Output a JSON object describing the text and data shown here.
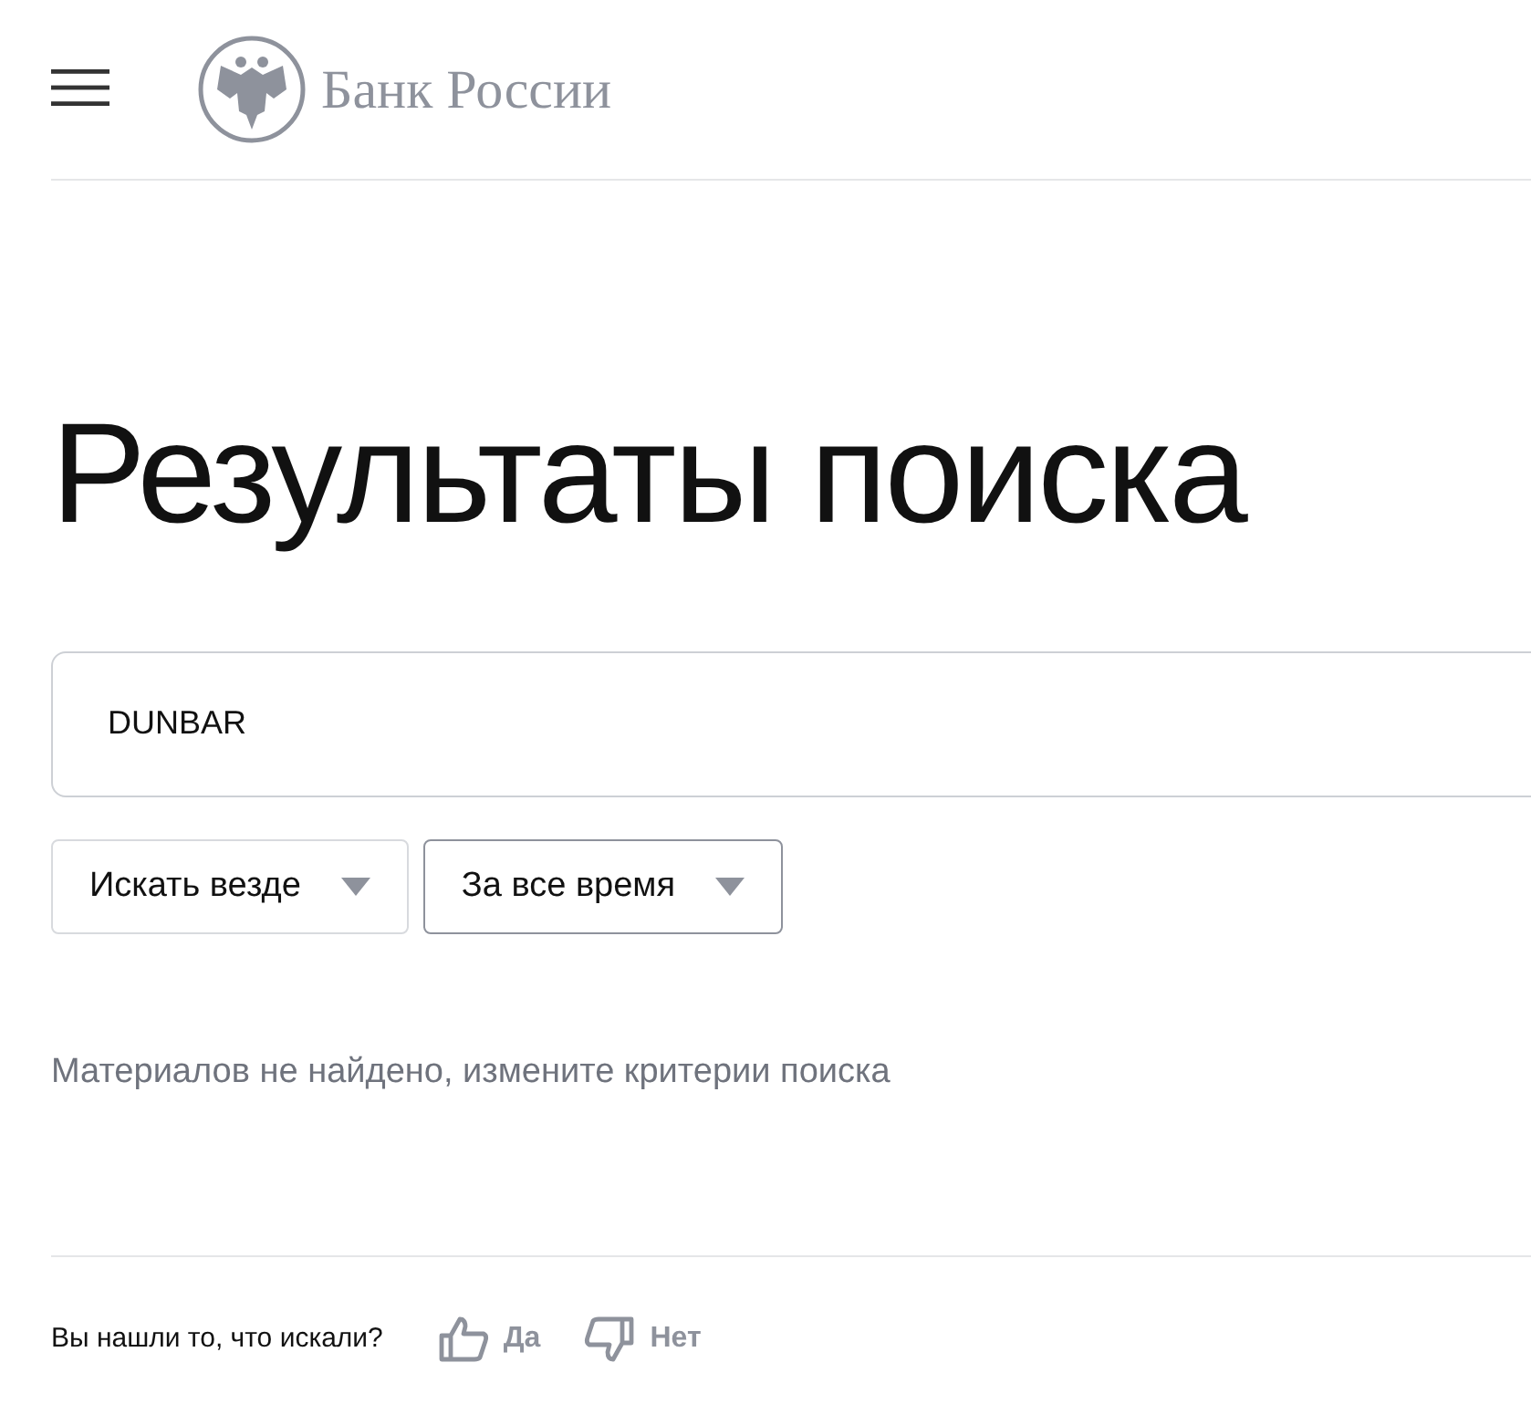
{
  "header": {
    "logo_text": "Банк России"
  },
  "title": "Результаты поиска",
  "search": {
    "value": "DUNBAR"
  },
  "filters": [
    {
      "label": "Искать везде",
      "selected": false
    },
    {
      "label": "За все время",
      "selected": true
    }
  ],
  "message": "Материалов не найдено, измените критерии поиска",
  "feedback": {
    "question": "Вы нашли то, что искали?",
    "yes": "Да",
    "no": "Нет"
  }
}
